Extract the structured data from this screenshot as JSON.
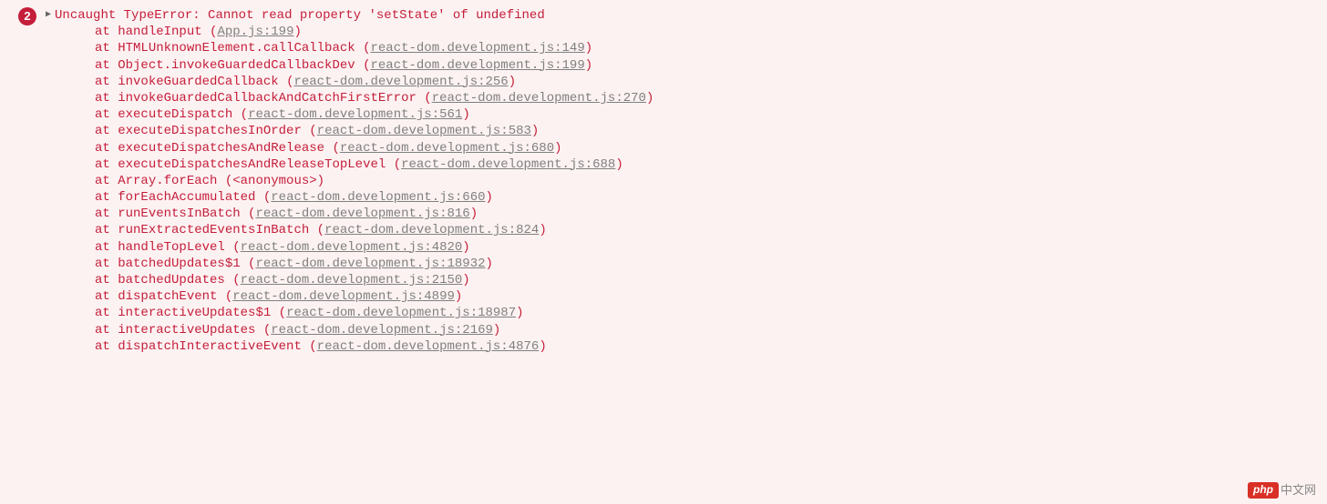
{
  "error": {
    "badge_count": "2",
    "title": "Uncaught TypeError: Cannot read property 'setState' of undefined",
    "stack": [
      {
        "fn": "handleInput",
        "file": "App.js:199"
      },
      {
        "fn": "HTMLUnknownElement.callCallback",
        "file": "react-dom.development.js:149"
      },
      {
        "fn": "Object.invokeGuardedCallbackDev",
        "file": "react-dom.development.js:199"
      },
      {
        "fn": "invokeGuardedCallback",
        "file": "react-dom.development.js:256"
      },
      {
        "fn": "invokeGuardedCallbackAndCatchFirstError",
        "file": "react-dom.development.js:270"
      },
      {
        "fn": "executeDispatch",
        "file": "react-dom.development.js:561"
      },
      {
        "fn": "executeDispatchesInOrder",
        "file": "react-dom.development.js:583"
      },
      {
        "fn": "executeDispatchesAndRelease",
        "file": "react-dom.development.js:680"
      },
      {
        "fn": "executeDispatchesAndReleaseTopLevel",
        "file": "react-dom.development.js:688"
      },
      {
        "fn": "Array.forEach",
        "file": "<anonymous>",
        "anonymous": true
      },
      {
        "fn": "forEachAccumulated",
        "file": "react-dom.development.js:660"
      },
      {
        "fn": "runEventsInBatch",
        "file": "react-dom.development.js:816"
      },
      {
        "fn": "runExtractedEventsInBatch",
        "file": "react-dom.development.js:824"
      },
      {
        "fn": "handleTopLevel",
        "file": "react-dom.development.js:4820"
      },
      {
        "fn": "batchedUpdates$1",
        "file": "react-dom.development.js:18932"
      },
      {
        "fn": "batchedUpdates",
        "file": "react-dom.development.js:2150"
      },
      {
        "fn": "dispatchEvent",
        "file": "react-dom.development.js:4899"
      },
      {
        "fn": "interactiveUpdates$1",
        "file": "react-dom.development.js:18987"
      },
      {
        "fn": "interactiveUpdates",
        "file": "react-dom.development.js:2169"
      },
      {
        "fn": "dispatchInteractiveEvent",
        "file": "react-dom.development.js:4876"
      }
    ]
  },
  "watermark": {
    "badge": "php",
    "text": "中文网"
  }
}
